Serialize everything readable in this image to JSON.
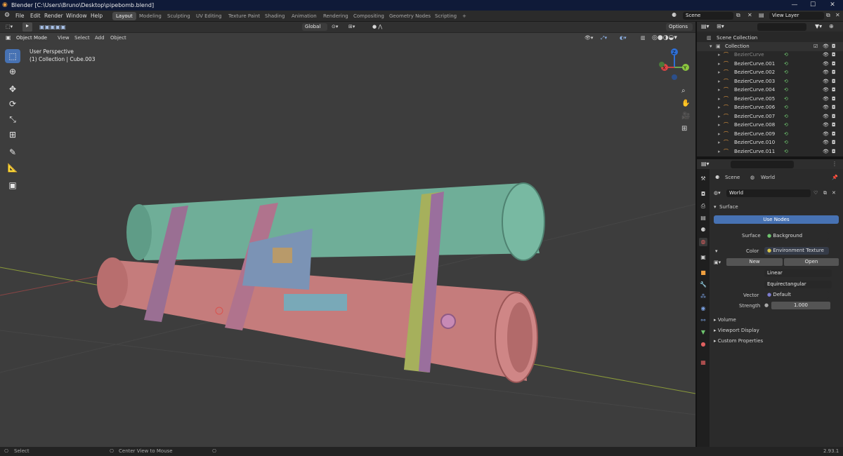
{
  "window": {
    "title": "Blender [C:\\Users\\Bruno\\Desktop\\pipebomb.blend]",
    "minimize": "—",
    "maximize": "☐",
    "close": "✕"
  },
  "menu": [
    "File",
    "Edit",
    "Render",
    "Window",
    "Help"
  ],
  "workspaces": [
    "Layout",
    "Modeling",
    "Sculpting",
    "UV Editing",
    "Texture Paint",
    "Shading",
    "Animation",
    "Rendering",
    "Compositing",
    "Geometry Nodes",
    "Scripting"
  ],
  "workspace_add": "+",
  "scene_field": "Scene",
  "viewlayer_field": "View Layer",
  "viewport": {
    "mode": "Object Mode",
    "menus": [
      "View",
      "Select",
      "Add",
      "Object"
    ],
    "orientation": "Global",
    "options": "Options",
    "overlay_title": "User Perspective",
    "overlay_sub": "(1) Collection | Cube.003",
    "gizmo": {
      "x": "X",
      "y": "Y",
      "z": "Z"
    }
  },
  "outliner": {
    "root": "Scene Collection",
    "collection": "Collection",
    "items": [
      "BezierCurve",
      "BezierCurve.001",
      "BezierCurve.002",
      "BezierCurve.003",
      "BezierCurve.004",
      "BezierCurve.005",
      "BezierCurve.006",
      "BezierCurve.007",
      "BezierCurve.008",
      "BezierCurve.009",
      "BezierCurve.010",
      "BezierCurve.011"
    ]
  },
  "properties": {
    "breadcrumb_scene": "Scene",
    "breadcrumb_world": "World",
    "world_name": "World",
    "surface_panel": "Surface",
    "use_nodes": "Use Nodes",
    "surface_label": "Surface",
    "surface_value": "Background",
    "color_label": "Color",
    "color_value": "Environment Texture",
    "new_label": "New",
    "open_label": "Open",
    "interpolation": "Linear",
    "projection": "Equirectangular",
    "vector_label": "Vector",
    "vector_value": "Default",
    "strength_label": "Strength",
    "strength_value": "1.000",
    "panels": [
      "Volume",
      "Viewport Display",
      "Custom Properties"
    ]
  },
  "status": {
    "select": "Select",
    "center": "Center View to Mouse",
    "version": "2.93.1"
  },
  "colors": {
    "accent": "#4772b3",
    "green_tube": "#6fae98",
    "red_tube": "#c57c7c",
    "viewport_bg": "#3d3d3d"
  }
}
